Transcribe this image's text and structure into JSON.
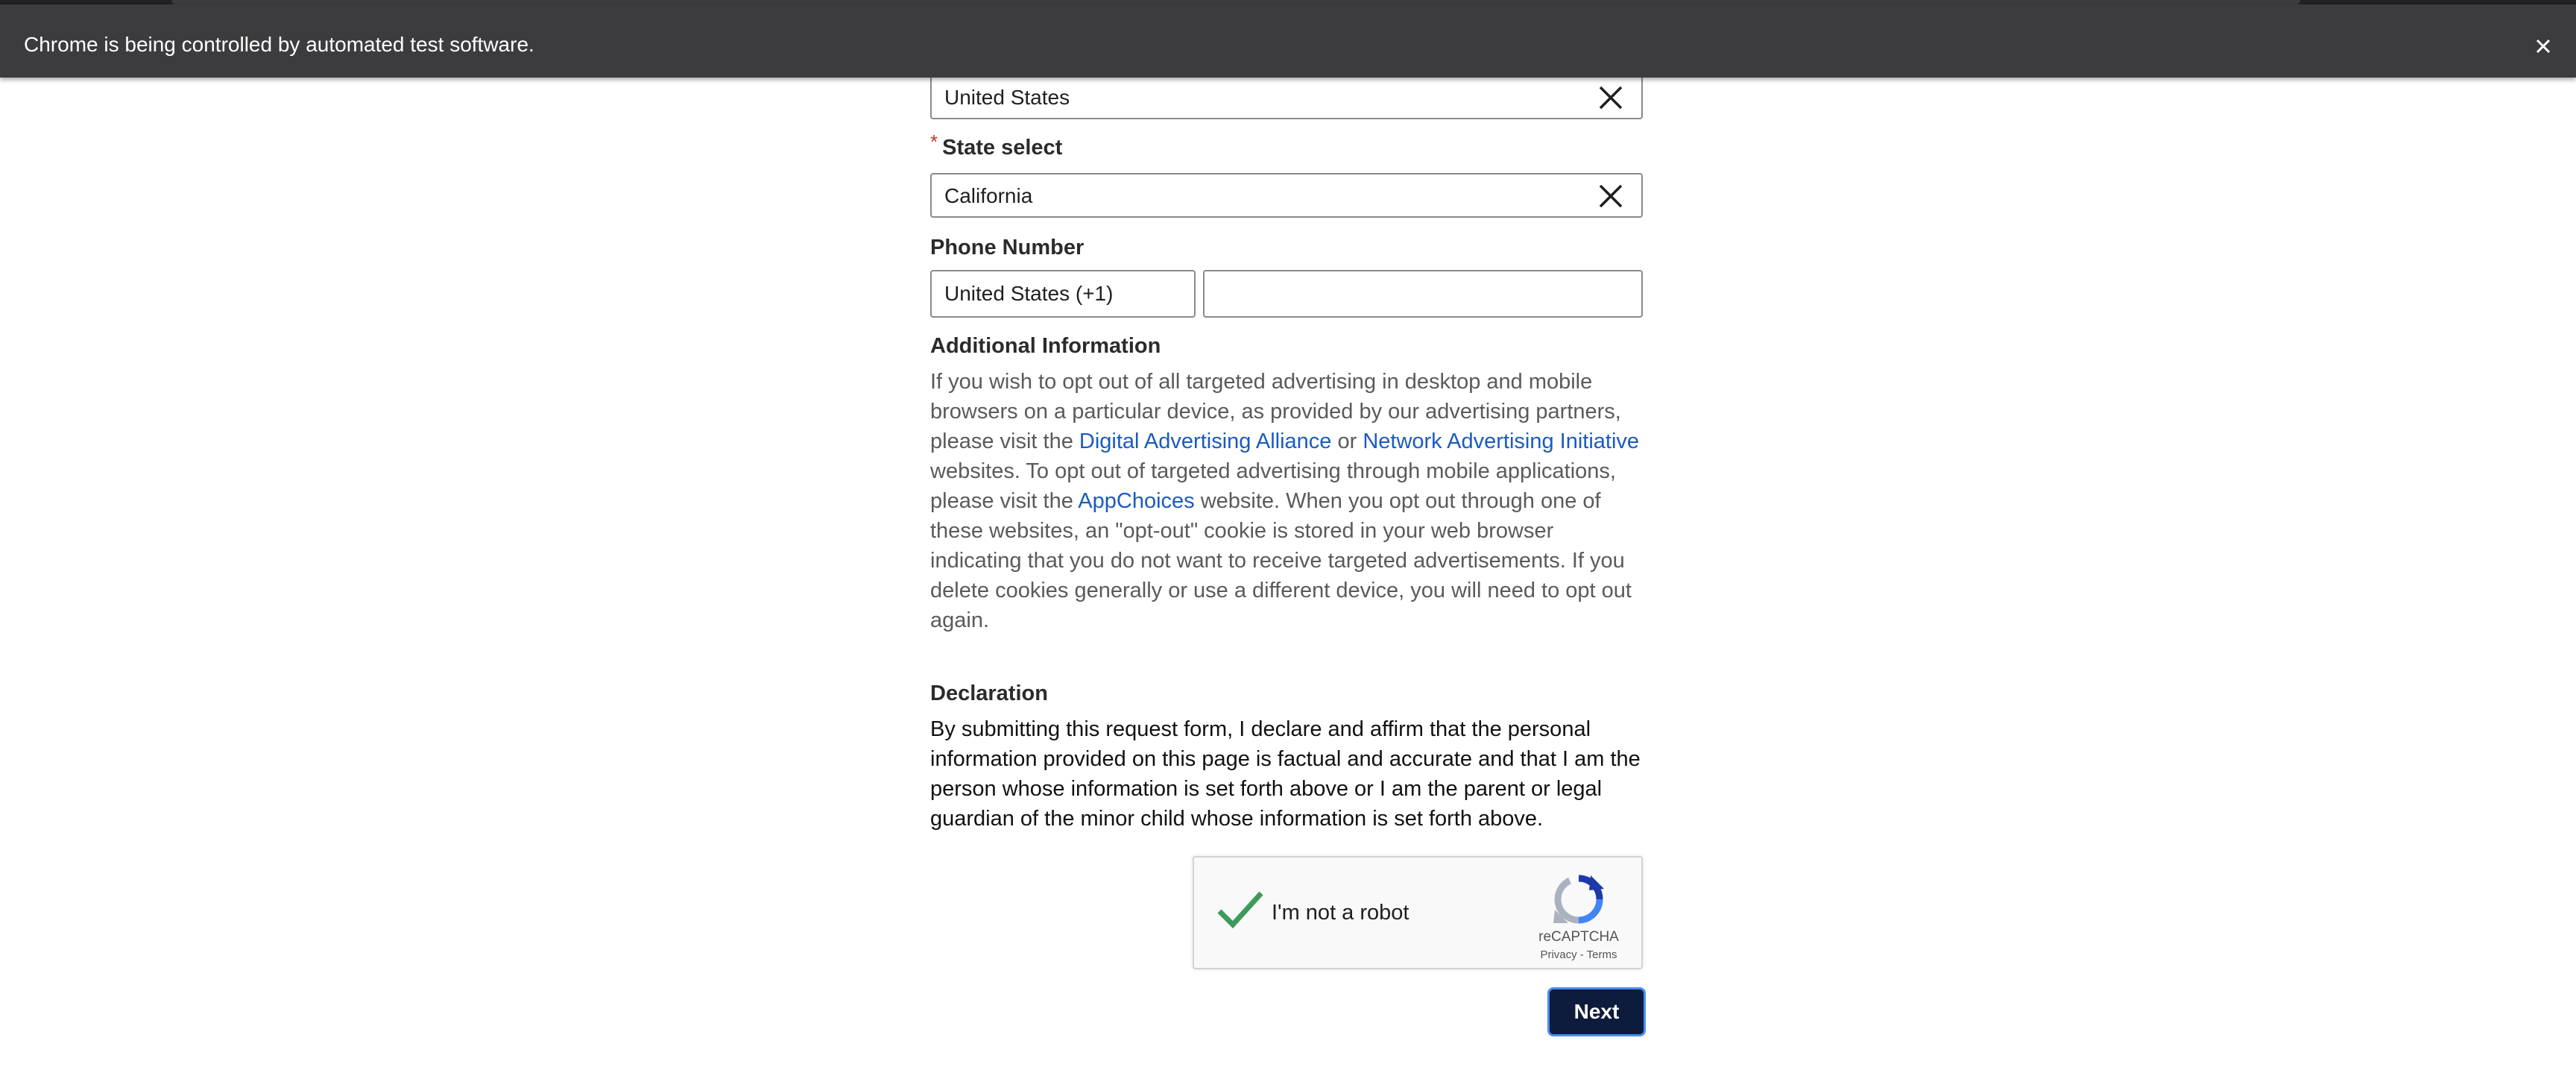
{
  "infobar": {
    "message": "Chrome is being controlled by automated test software.",
    "close_icon": "close-icon"
  },
  "form": {
    "country": {
      "value": "United States",
      "clear_icon": "close-icon"
    },
    "state": {
      "label": "State select",
      "required_marker": "*",
      "value": "California",
      "clear_icon": "close-icon"
    },
    "phone": {
      "label": "Phone Number",
      "country_code": "United States (+1)",
      "number_value": "",
      "number_placeholder": ""
    },
    "additional_info": {
      "heading": "Additional Information",
      "text_1": "If you wish to opt out of all targeted advertising in desktop and mobile browsers on a particular device, as provided by our advertising partners, please visit the ",
      "link_daa": "Digital Advertising Alliance",
      "text_2": " or ",
      "link_nai": "Network Advertising Initiative",
      "text_3": " websites. To opt out of targeted advertising through mobile applications, please visit the ",
      "link_appchoices": "AppChoices",
      "text_4": " website. When you opt out through one of these websites, an \"opt-out\" cookie is stored in your web browser indicating that you do not want to receive targeted advertisements. If you delete cookies generally or use a different device, you will need to opt out again."
    },
    "declaration": {
      "heading": "Declaration",
      "text": "By submitting this request form, I declare and affirm that the personal information provided on this page is factual and accurate and that I am the person whose information is set forth above or I am the parent or legal guardian of the minor child whose information is set forth above."
    },
    "recaptcha": {
      "label": "I'm not a robot",
      "checked": true,
      "brand": "reCAPTCHA",
      "links": "Privacy - Terms",
      "check_icon": "checkmark-icon",
      "logo_icon": "recaptcha-logo-icon"
    },
    "next_label": "Next"
  },
  "colors": {
    "infobar_bg": "#3c3c3f",
    "link": "#1a5bbf",
    "button_bg": "#0d1b3d",
    "button_focus": "#4a8df0",
    "required": "#c0392b",
    "check": "#3e9a5a"
  }
}
